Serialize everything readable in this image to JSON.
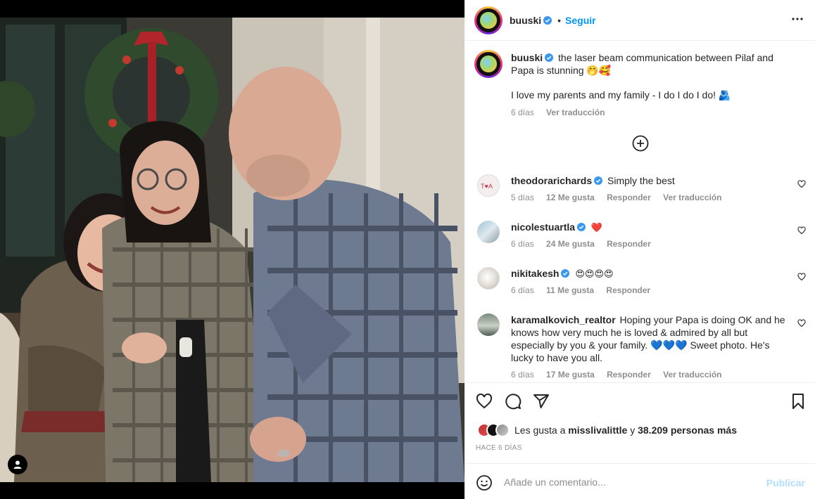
{
  "post": {
    "author": "buuski",
    "follow_label": "Seguir",
    "separator": "•",
    "caption_text": "the laser beam communication between Pilaf and Papa is stunning 🤭🥰",
    "caption_line2": "I love my parents and my family - I do I do I do! 🫂",
    "caption_time": "6 días",
    "caption_translate": "Ver traducción"
  },
  "comments": [
    {
      "user": "theodorarichards",
      "text": "Simply the best",
      "time": "5 días",
      "likes": "12 Me gusta",
      "reply": "Responder",
      "translate": "Ver traducción"
    },
    {
      "user": "nicolestuartla",
      "text": "❤️",
      "time": "6 días",
      "likes": "24 Me gusta",
      "reply": "Responder"
    },
    {
      "user": "nikitakesh",
      "text": "😍😍😍😍",
      "time": "6 días",
      "likes": "11 Me gusta",
      "reply": "Responder"
    },
    {
      "user": "karamalkovich_realtor",
      "text": "Hoping your Papa is doing OK and he knows how very much he is loved & admired by all but especially by you & your family. 💙💙💙 Sweet photo. He's lucky to have you all.",
      "time": "6 días",
      "likes": "17 Me gusta",
      "reply": "Responder",
      "translate": "Ver traducción"
    }
  ],
  "likes": {
    "prefix": "Les gusta a",
    "user": "misslivalittle",
    "connector": "y",
    "others": "38.209 personas más"
  },
  "posted_ago": "HACE 6 DÍAS",
  "composer": {
    "placeholder": "Añade un comentario...",
    "publish_label": "Publicar"
  },
  "colors": {
    "link_blue": "#0095f6",
    "publish_disabled": "#b2dffc",
    "muted": "#8e8e8e",
    "verified": "#3897f0"
  },
  "icons": [
    "more-options-icon",
    "verified-icon",
    "load-more-icon",
    "like-icon",
    "comment-icon",
    "share-icon",
    "save-icon",
    "emoji-icon",
    "tag-user-icon"
  ]
}
